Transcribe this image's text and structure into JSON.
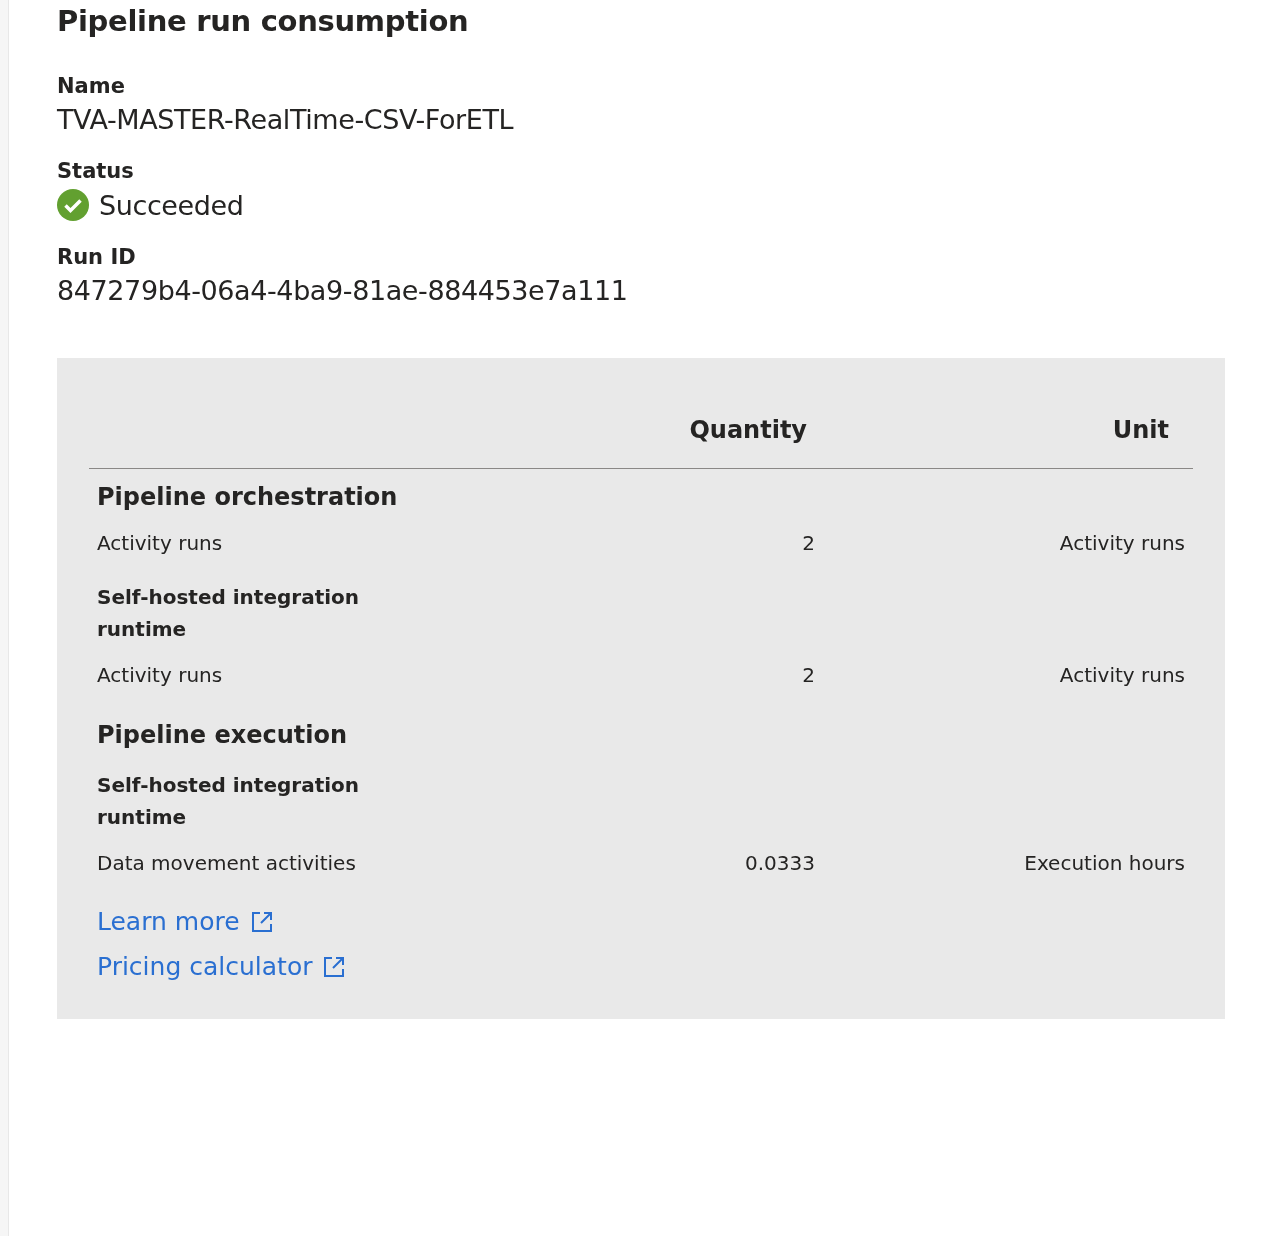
{
  "title": "Pipeline run consumption",
  "fields": [
    {
      "kind": "text",
      "label": "Name",
      "value": "TVA-MASTER-RealTime-CSV-ForETL"
    },
    {
      "kind": "status",
      "label": "Status",
      "value": "Succeeded"
    },
    {
      "kind": "text",
      "label": "Run ID",
      "value": "847279b4-06a4-4ba9-81ae-884453e7a111"
    }
  ],
  "table": {
    "columns": [
      "Quantity",
      "Unit"
    ],
    "rows": [
      {
        "kind": "section",
        "label": "Pipeline orchestration"
      },
      {
        "kind": "item",
        "name": "Activity runs",
        "quantity": "2",
        "unit": "Activity runs"
      },
      {
        "kind": "subsection",
        "label": "Self-hosted integration runtime"
      },
      {
        "kind": "item",
        "name": "Activity runs",
        "quantity": "2",
        "unit": "Activity runs"
      },
      {
        "kind": "section",
        "label": "Pipeline execution"
      },
      {
        "kind": "subsection",
        "label": "Self-hosted integration runtime"
      },
      {
        "kind": "item",
        "name": "Data movement activities",
        "quantity": "0.0333",
        "unit": "Execution hours"
      }
    ]
  },
  "links": [
    "Learn more",
    "Pricing calculator"
  ]
}
